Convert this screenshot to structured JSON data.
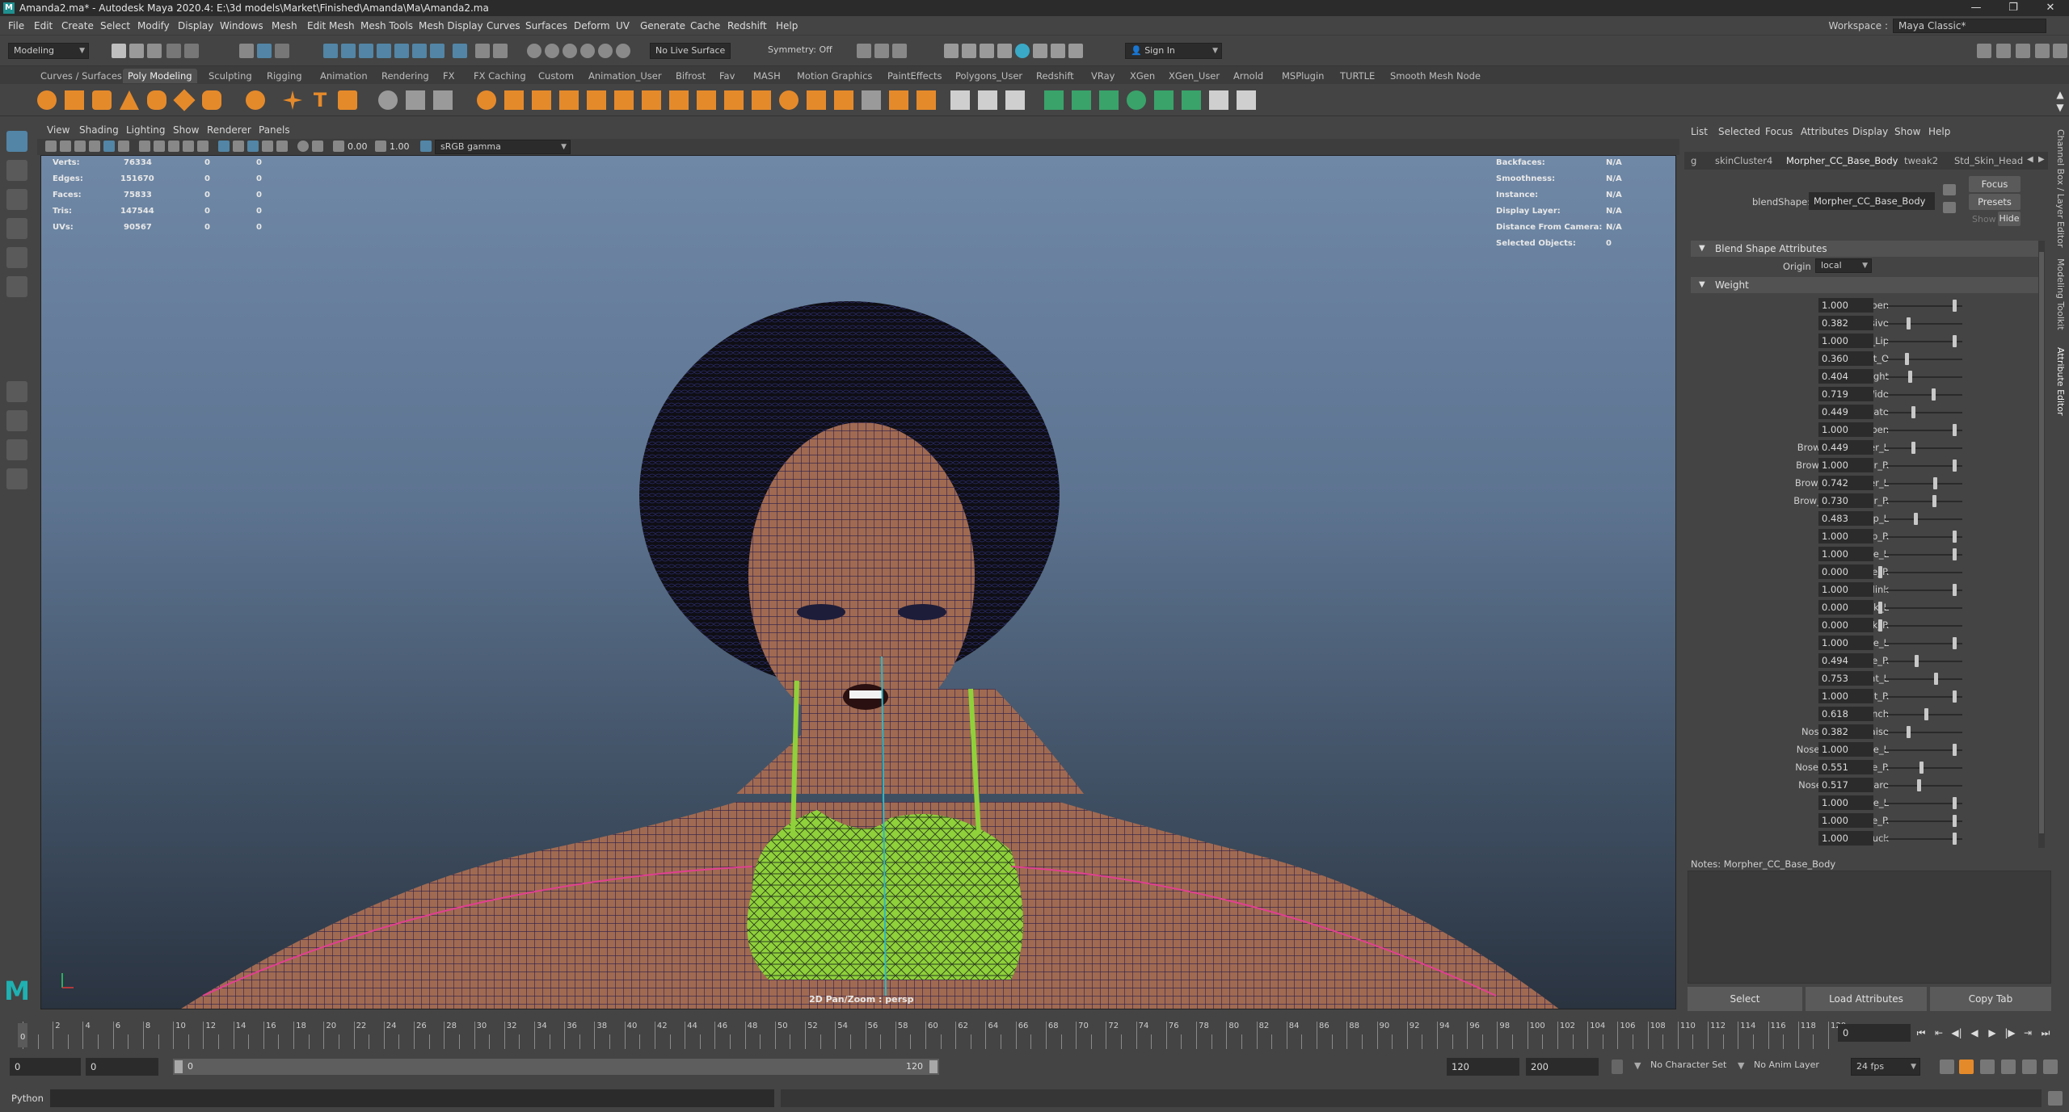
{
  "window": {
    "title": "Amanda2.ma* - Autodesk Maya 2020.4: E:\\3d models\\Market\\Finished\\Amanda\\Ma\\Amanda2.ma",
    "icon_letter": "M",
    "minimize": "—",
    "maximize": "❐",
    "close": "✕"
  },
  "menu": [
    "File",
    "Edit",
    "Create",
    "Select",
    "Modify",
    "Display",
    "Windows",
    "Mesh",
    "Edit Mesh",
    "Mesh Tools",
    "Mesh Display",
    "Curves",
    "Surfaces",
    "Deform",
    "UV",
    "Generate",
    "Cache",
    "Redshift",
    "Help"
  ],
  "workspace": {
    "label": "Workspace :",
    "value": "Maya Classic*"
  },
  "statusline": {
    "mode": "Modeling",
    "live_surface": "No Live Surface",
    "symmetry": "Symmetry: Off",
    "sign_in": "Sign In"
  },
  "shelf_tabs": [
    "Curves / Surfaces",
    "Poly Modeling",
    "Sculpting",
    "Rigging",
    "Animation",
    "Rendering",
    "FX",
    "FX Caching",
    "Custom",
    "Animation_User",
    "Bifrost",
    "Fav",
    "MASH",
    "Motion Graphics",
    "PaintEffects",
    "Polygons_User",
    "Redshift",
    "VRay",
    "XGen",
    "XGen_User",
    "Arnold",
    "MSPlugin",
    "TURTLE",
    "Smooth Mesh Node"
  ],
  "shelf_active": "Poly Modeling",
  "viewport": {
    "menus": [
      "View",
      "Shading",
      "Lighting",
      "Show",
      "Renderer",
      "Panels"
    ],
    "exposure": "0.00",
    "gamma": "1.00",
    "color_space": "sRGB gamma",
    "camera_label": "2D Pan/Zoom : persp",
    "hud_left": [
      {
        "label": "Verts:",
        "v1": "76334",
        "v2": "0",
        "v3": "0"
      },
      {
        "label": "Edges:",
        "v1": "151670",
        "v2": "0",
        "v3": "0"
      },
      {
        "label": "Faces:",
        "v1": "75833",
        "v2": "0",
        "v3": "0"
      },
      {
        "label": "Tris:",
        "v1": "147544",
        "v2": "0",
        "v3": "0"
      },
      {
        "label": "UVs:",
        "v1": "90567",
        "v2": "0",
        "v3": "0"
      }
    ],
    "hud_right": [
      {
        "label": "Backfaces:",
        "value": "N/A"
      },
      {
        "label": "Smoothness:",
        "value": "N/A"
      },
      {
        "label": "Instance:",
        "value": "N/A"
      },
      {
        "label": "Display Layer:",
        "value": "N/A"
      },
      {
        "label": "Distance From Camera:",
        "value": "N/A"
      },
      {
        "label": "Selected Objects:",
        "value": "0"
      }
    ]
  },
  "attribute_editor": {
    "menus": [
      "List",
      "Selected",
      "Focus",
      "Attributes",
      "Display",
      "Show",
      "Help"
    ],
    "tabs": [
      "g",
      "skinCluster4",
      "Morpher_CC_Base_Body",
      "tweak2",
      "Std_Skin_Head"
    ],
    "active_tab": "Morpher_CC_Base_Body",
    "node_label": "blendShape:",
    "node_name": "Morpher_CC_Base_Body",
    "focus": "Focus",
    "presets": "Presets",
    "show": "Show",
    "hide": "Hide",
    "section_blend": "Blend Shape Attributes",
    "origin_label": "Origin",
    "origin_value": "local",
    "section_weight": "Weight",
    "weights": [
      {
        "name": "Open",
        "value": "1.000"
      },
      {
        "name": "Explosive",
        "value": "0.382"
      },
      {
        "name": "Dental_Lip",
        "value": "1.000"
      },
      {
        "name": "Tight_O",
        "value": "0.360"
      },
      {
        "name": "Tight",
        "value": "0.404"
      },
      {
        "name": "Wide",
        "value": "0.719"
      },
      {
        "name": "Affricate",
        "value": "0.449"
      },
      {
        "name": "Lip_Open",
        "value": "1.000"
      },
      {
        "name": "Brow_Raise_Inner_L",
        "value": "0.449"
      },
      {
        "name": "Brow_Raise_Inner_R",
        "value": "1.000"
      },
      {
        "name": "Brow_Raise_Outer_L",
        "value": "0.742"
      },
      {
        "name": "Brow_Raise_Outer_R",
        "value": "0.730"
      },
      {
        "name": "Brow_Drop_L",
        "value": "0.483"
      },
      {
        "name": "Brow_Drop_R",
        "value": "1.000"
      },
      {
        "name": "Brow_Raise_L",
        "value": "1.000"
      },
      {
        "name": "Brow_Raise_R",
        "value": "0.000"
      },
      {
        "name": "Eye_Blink",
        "value": "1.000"
      },
      {
        "name": "Eye_Blink_L",
        "value": "0.000"
      },
      {
        "name": "Eye_Blink_R",
        "value": "0.000"
      },
      {
        "name": "Eye_Wide_L",
        "value": "1.000"
      },
      {
        "name": "Eye_Wide_R",
        "value": "0.494"
      },
      {
        "name": "Eye_Squint_L",
        "value": "0.753"
      },
      {
        "name": "Eye_Squint_R",
        "value": "1.000"
      },
      {
        "name": "Nose_Scrunch",
        "value": "0.618"
      },
      {
        "name": "Nose_Flanks_Raise",
        "value": "0.382"
      },
      {
        "name": "Nose_Flank_Raise_L",
        "value": "1.000"
      },
      {
        "name": "Nose_Flank_Raise_R",
        "value": "0.551"
      },
      {
        "name": "Nose_Nostrils_Flare",
        "value": "0.517"
      },
      {
        "name": "Cheek_Raise_L",
        "value": "1.000"
      },
      {
        "name": "Cheek_Raise_R",
        "value": "1.000"
      },
      {
        "name": "Cheek_Suck",
        "value": "1.000"
      }
    ],
    "notes_label": "Notes:",
    "notes_node": "Morpher_CC_Base_Body",
    "btn_select": "Select",
    "btn_load": "Load Attributes",
    "btn_copy": "Copy Tab",
    "side_tabs": [
      "Channel Box / Layer Editor",
      "Modeling Toolkit",
      "Attribute Editor"
    ]
  },
  "timeline": {
    "current_frame": "0",
    "ticks": [
      "2",
      "4",
      "6",
      "8",
      "10",
      "12",
      "14",
      "16",
      "18",
      "20",
      "22",
      "24",
      "26",
      "28",
      "30",
      "32",
      "34",
      "36",
      "38",
      "40",
      "42",
      "44",
      "46",
      "48",
      "50",
      "52",
      "54",
      "56",
      "58",
      "60",
      "62",
      "64",
      "66",
      "68",
      "70",
      "72",
      "74",
      "76",
      "78",
      "80",
      "82",
      "84",
      "86",
      "88",
      "90",
      "92",
      "94",
      "96",
      "98",
      "100",
      "102",
      "104",
      "106",
      "108",
      "110",
      "112",
      "114",
      "116",
      "118",
      "120"
    ],
    "frame_field": "0",
    "start_field": "0",
    "start_inner": "0",
    "range_start_label": "0",
    "range_end_label": "120",
    "end_inner": "120",
    "end_field": "200",
    "character_set": "No Character Set",
    "anim_layer": "No Anim Layer",
    "fps": "24 fps"
  },
  "command_line": {
    "label": "Python"
  },
  "colors": {
    "accent": "#5285a6",
    "shelf_orange": "#e58a2b",
    "shelf_green": "#3aa36a",
    "bra_green": "#8fd13a"
  }
}
